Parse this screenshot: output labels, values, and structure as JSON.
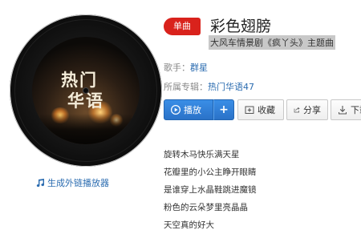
{
  "cover": {
    "line1": "热门",
    "line2": "华语"
  },
  "external_player_link": "生成外链播放器",
  "song": {
    "badge": "单曲",
    "title": "彩色翅膀",
    "subtitle": "大风车情景剧《疯丫头》主题曲"
  },
  "meta": {
    "singer_label": "歌手：",
    "singer_value": "群星",
    "album_label": "所属专辑：",
    "album_value": "热门华语47"
  },
  "actions": {
    "play": "播放",
    "add": "+",
    "favorite": "收藏",
    "share": "分享",
    "download": "下载"
  },
  "lyrics": [
    "旋转木马快乐满天星",
    "花瓣里的小公主睁开眼睛",
    "是谁穿上水晶鞋跳进魔镜",
    "粉色的云朵梦里亮晶晶",
    "天空真的好大"
  ],
  "colors": {
    "badge": "#d9221c",
    "link": "#2b6cb0",
    "primary_button": "#2a72c8"
  }
}
